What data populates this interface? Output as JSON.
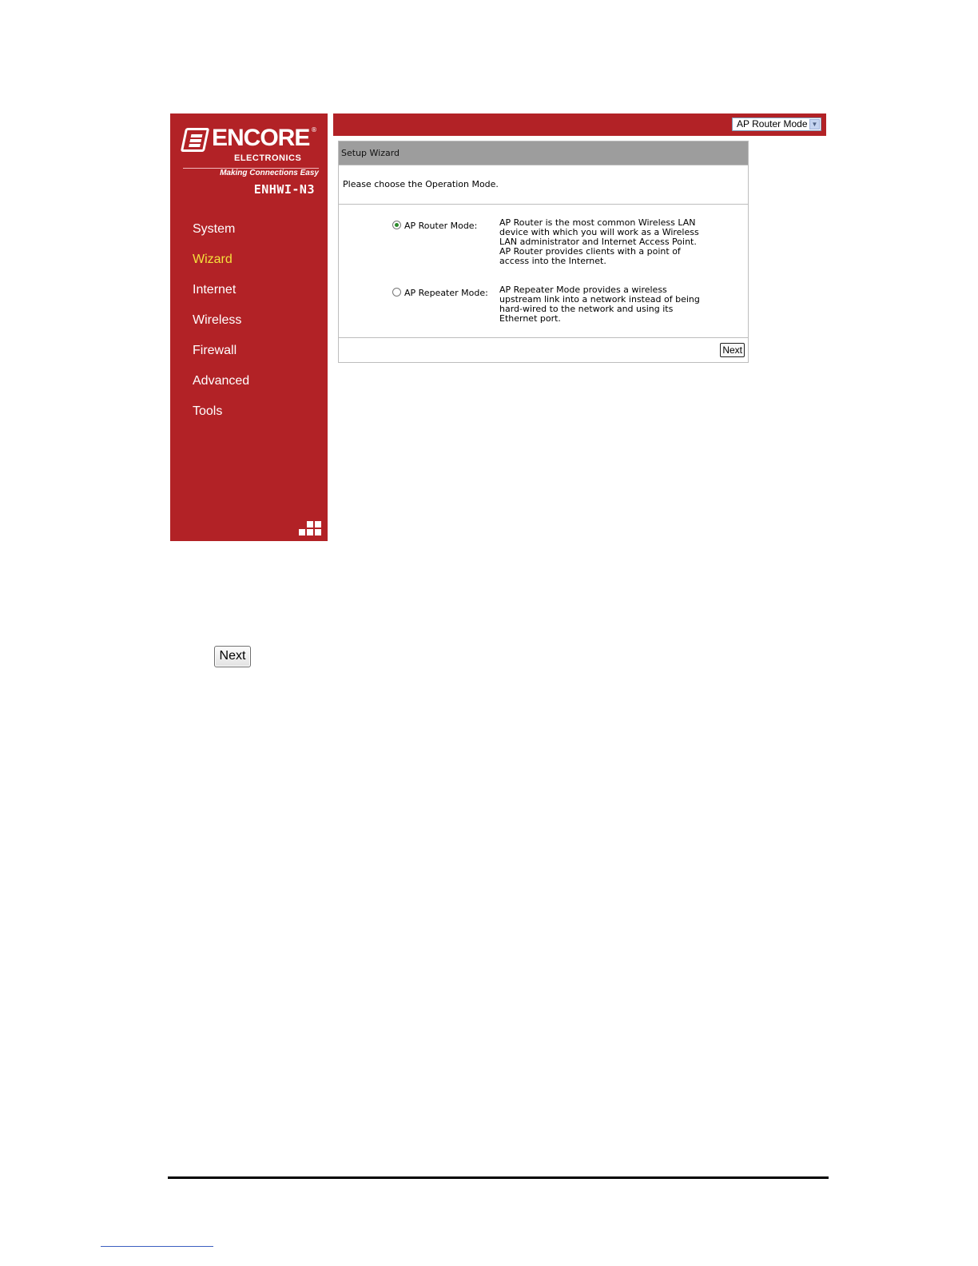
{
  "brand": {
    "name": "ENCORE",
    "sub": "ELECTRONICS",
    "tagline": "Making Connections Easy",
    "registered": "®",
    "model": "ENHWI-N3"
  },
  "sidebar": {
    "items": [
      {
        "label": "System"
      },
      {
        "label": "Wizard"
      },
      {
        "label": "Internet"
      },
      {
        "label": "Wireless"
      },
      {
        "label": "Firewall"
      },
      {
        "label": "Advanced"
      },
      {
        "label": "Tools"
      }
    ],
    "active": "Wizard"
  },
  "topbar": {
    "mode_select": {
      "selected": "AP Router Mode"
    }
  },
  "wizard": {
    "title": "Setup Wizard",
    "prompt": "Please choose the Operation Mode.",
    "options": [
      {
        "label": "AP Router Mode:",
        "checked": true,
        "description_lines": [
          "AP Router is the most common Wireless LAN",
          "device with which you will work as a Wireless",
          "LAN administrator and Internet Access Point.",
          "AP Router provides clients with a point of",
          "access into the Internet."
        ]
      },
      {
        "label": "AP Repeater Mode:",
        "checked": false,
        "description_lines": [
          "AP Repeater Mode provides a wireless",
          "upstream link into a network instead of being",
          "hard-wired to the network and using its",
          "Ethernet port."
        ]
      }
    ],
    "next_label": "Next"
  },
  "doc": {
    "next_button_label": "Next"
  },
  "colors": {
    "brand_red": "#b22226",
    "active_nav": "#f4e13c",
    "header_gray": "#9d9d9d"
  }
}
